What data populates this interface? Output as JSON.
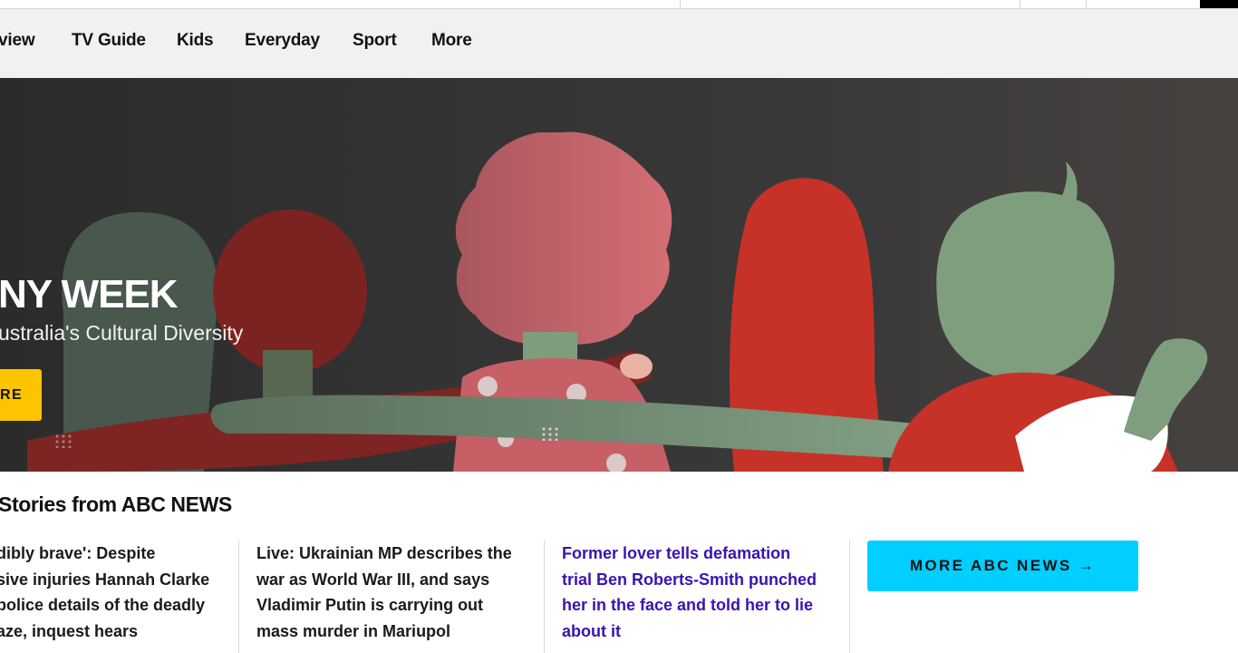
{
  "nav": {
    "items": [
      {
        "label": "view"
      },
      {
        "label": "TV Guide"
      },
      {
        "label": "Kids"
      },
      {
        "label": "Everyday"
      },
      {
        "label": "Sport"
      },
      {
        "label": "More"
      }
    ]
  },
  "hero": {
    "title": "NY WEEK",
    "subtitle": "ustralia's Cultural Diversity",
    "button_label": "RE",
    "colors": {
      "red": "#c63128",
      "pink": "#c85d66",
      "green": "#7f9e7e",
      "dark_green": "#4b5a4f",
      "maroon": "#7b2220",
      "yellow": "#ffc400"
    }
  },
  "stories": {
    "section_title": "Stories from ABC NEWS",
    "items": [
      {
        "lines": [
          "dibly brave': Despite",
          "sive injuries Hannah Clarke",
          "police details of the deadly",
          "aze, inquest hears"
        ]
      },
      {
        "lines": [
          "Live: Ukrainian MP describes the",
          "war as World War III, and says",
          "Vladimir Putin is carrying out",
          "mass murder in Mariupol"
        ]
      },
      {
        "lines": [
          "Former lover tells defamation",
          "trial Ben Roberts-Smith punched",
          "her in the face and told her to lie",
          "about it"
        ]
      }
    ],
    "more_button": "MORE ABC NEWS →"
  }
}
